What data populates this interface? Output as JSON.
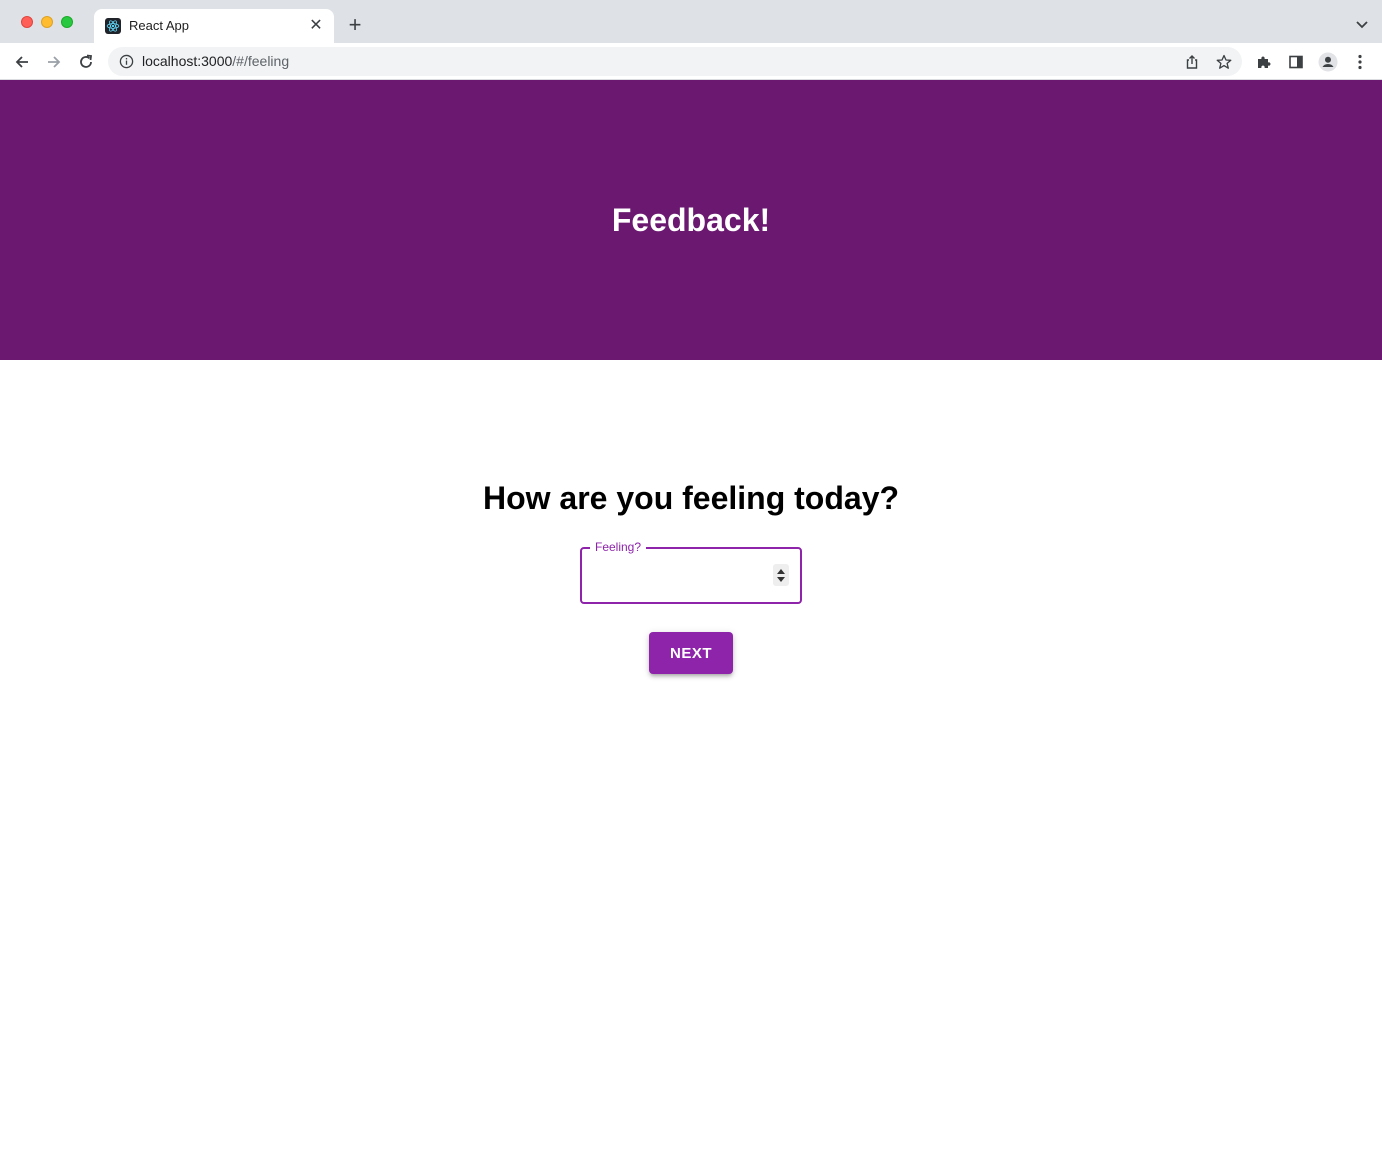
{
  "browser": {
    "tab_title": "React App",
    "tab_close": "✕",
    "new_tab": "+",
    "url_host": "localhost:3000",
    "url_path": "/#/feeling",
    "icons": {
      "favicon": "react-icon",
      "back": "arrow-left-icon",
      "forward": "arrow-right-icon",
      "reload": "reload-icon",
      "info": "info-icon",
      "share": "share-icon",
      "bookmark": "star-icon",
      "extensions": "puzzle-icon",
      "side_panel": "side-panel-icon",
      "profile": "profile-icon",
      "menu": "kebab-menu-icon",
      "tab_search": "chevron-down-icon"
    }
  },
  "header": {
    "title": "Feedback!"
  },
  "page": {
    "question": "How are you feeling today?",
    "feeling_field": {
      "label": "Feeling?",
      "value": ""
    },
    "next_button": "NEXT"
  },
  "colors": {
    "header_bg": "#6a1870",
    "accent": "#8e24aa",
    "text": "#000000"
  }
}
